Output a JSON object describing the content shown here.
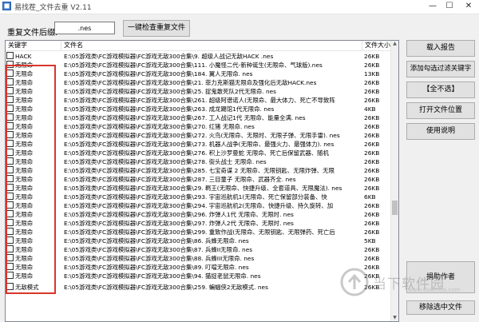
{
  "window": {
    "title": "易找茬_文件去重 V2.11",
    "min_glyph": "—",
    "max_glyph": "☐",
    "close_glyph": "✕"
  },
  "toolbar": {
    "suffix_label": "重复文件后缀:",
    "suffix_value": ".nes",
    "check_button": "一键检查重复文件"
  },
  "list": {
    "columns": {
      "keyword": "关键字",
      "filename": "文件名",
      "size": "文件大小"
    },
    "rows": [
      {
        "keyword": "HACK",
        "filename": "E:\\05游戏类\\FC游戏模拟器\\FC游戏无敌300合集\\9. 超级人战记无敌HACK .nes",
        "size": "26KB"
      },
      {
        "keyword": "无限命",
        "filename": "E:\\05游戏类\\FC游戏模拟器\\FC游戏无敌300合集\\111. 小魔怪二代-新种诞生(无限命、气球版).nes",
        "size": "26KB"
      },
      {
        "keyword": "无限命",
        "filename": "E:\\05游戏类\\FC游戏模拟器\\FC游戏无敌300合集\\184. 翼人无限命. nes",
        "size": "13KB"
      },
      {
        "keyword": "无限命",
        "filename": "E:\\05游戏类\\FC游戏模拟器\\FC游戏无敌300合集\\21. 菲力克斯猫无限命及强化后无敌HACK.nes",
        "size": "26KB"
      },
      {
        "keyword": "无限命",
        "filename": "E:\\05游戏类\\FC游戏模拟器\\FC游戏无敌300合集\\25. 捉鬼敢死队2代无限命. nes",
        "size": "26KB"
      },
      {
        "keyword": "无限命",
        "filename": "E:\\05游戏类\\FC游戏模拟器\\FC游戏无敌300合集\\261. 超级阿谱诺人(无限命、最大体力、死亡不导致阵",
        "size": "26KB"
      },
      {
        "keyword": "无限命",
        "filename": "E:\\05游戏类\\FC游戏模拟器\\FC游戏无敌300合集\\263. 成龙踢馆1代无限命. nes",
        "size": "4KB"
      },
      {
        "keyword": "无限命",
        "filename": "E:\\05游戏类\\FC游戏模拟器\\FC游戏无敌300合集\\267. 工人战记1代 无限命、能量全满. nes",
        "size": "26KB"
      },
      {
        "keyword": "无限命",
        "filename": "E:\\05游戏类\\FC游戏模拟器\\FC游戏无敌300合集\\270. 红猪 无限命. nes",
        "size": "26KB"
      },
      {
        "keyword": "无限命",
        "filename": "E:\\05游戏类\\FC游戏模拟器\\FC游戏无敌300合集\\272. 火鸟(无限命、无限时、无限子弹、无限手雷). nes",
        "size": "26KB"
      },
      {
        "keyword": "无限命",
        "filename": "E:\\05游戏类\\FC游戏模拟器\\FC游戏无敌300合集\\273. 机器人战争(无限命、最强火力、最强体力). nes",
        "size": "26KB"
      },
      {
        "keyword": "无限命",
        "filename": "E:\\05游戏类\\FC游戏模拟器\\FC游戏无敌300合集\\276. 积上沙罗曼蛇 无限命、死亡后保留武器、随机",
        "size": "26KB"
      },
      {
        "keyword": "无限命",
        "filename": "E:\\05游戏类\\FC游戏模拟器\\FC游戏无敌300合集\\278. 街头战士 无限命. nes",
        "size": "26KB"
      },
      {
        "keyword": "无限命",
        "filename": "E:\\05游戏类\\FC游戏模拟器\\FC游戏无敌300合集\\285. 七宝奇谋 2 无限命、无限钥匙、无限炸弹、无限",
        "size": "26KB"
      },
      {
        "keyword": "无限命",
        "filename": "E:\\05游戏类\\FC游戏模拟器\\FC游戏无敌300合集\\287. 三目童子 无限命、武器齐全. nes",
        "size": "26KB"
      },
      {
        "keyword": "无限命",
        "filename": "E:\\05游戏类\\FC游戏模拟器\\FC游戏无敌300合集\\29. 羁王(无限命、快捷升级、全套道具、无限魔法). nes",
        "size": "26KB"
      },
      {
        "keyword": "无限命",
        "filename": "E:\\05游戏类\\FC游戏模拟器\\FC游戏无敌300合集\\293. 宇宙巡航机1(无限命、死亡保留部分装备、快",
        "size": "6KB"
      },
      {
        "keyword": "无限命",
        "filename": "E:\\05游戏类\\FC游戏模拟器\\FC游戏无敌300合集\\294. 宇宙巡航机2(无限命、快捷升级、持久旋转、加",
        "size": "26KB"
      },
      {
        "keyword": "无限命",
        "filename": "E:\\05游戏类\\FC游戏模拟器\\FC游戏无敌300合集\\296. 炸弹人1代 无限命、无限时. nes",
        "size": "26KB"
      },
      {
        "keyword": "无限命",
        "filename": "E:\\05游戏类\\FC游戏模拟器\\FC游戏无敌300合集\\297. 炸弹人2代 无限命、无限时. nes",
        "size": "26KB"
      },
      {
        "keyword": "无限命",
        "filename": "E:\\05游戏类\\FC游戏模拟器\\FC游戏无敌300合集\\299. 重致作战(无限命、无限钥匙、无限弹药、死亡后",
        "size": "26KB"
      },
      {
        "keyword": "无限命",
        "filename": "E:\\05游戏类\\FC游戏模拟器\\FC游戏无敌300合集\\86. 兵蜂无限命. nes",
        "size": "5KB"
      },
      {
        "keyword": "无限命",
        "filename": "E:\\05游戏类\\FC游戏模拟器\\FC游戏无敌300合集\\87. 兵蜂II无限命. nes",
        "size": "26KB"
      },
      {
        "keyword": "无限命",
        "filename": "E:\\05游戏类\\FC游戏模拟器\\FC游戏无敌300合集\\88. 兵蜂III无限命. nes",
        "size": "26KB"
      },
      {
        "keyword": "无限命",
        "filename": "E:\\05游戏类\\FC游戏模拟器\\FC游戏无敌300合集\\89. 叮噹无限命. nes",
        "size": "26KB"
      },
      {
        "keyword": "无限命",
        "filename": "E:\\05游戏类\\FC游戏模拟器\\FC游戏无敌300合集\\94. 猫捉老鼠无限命. nes",
        "size": "26KB"
      },
      {
        "keyword": "无敌模式",
        "filename": "E:\\05游戏类\\FC游戏模拟器\\FC游戏无敌300合集\\259. 蝙蝠侠2无敌模式. nes",
        "size": "26KB"
      }
    ]
  },
  "sidebar": {
    "load_report": "载入报告",
    "add_keyword": "添加勾选过滤关键字",
    "select_all": "【全不选】",
    "open_location": "打开文件位置",
    "help": "使用说明",
    "donate": "捐助作者",
    "remove_files": "移除选中文件"
  },
  "scrollbar": {
    "up": "▲",
    "down": "▼"
  },
  "watermark": {
    "text": "当下软件园",
    "sub": "www.downxia.com"
  }
}
